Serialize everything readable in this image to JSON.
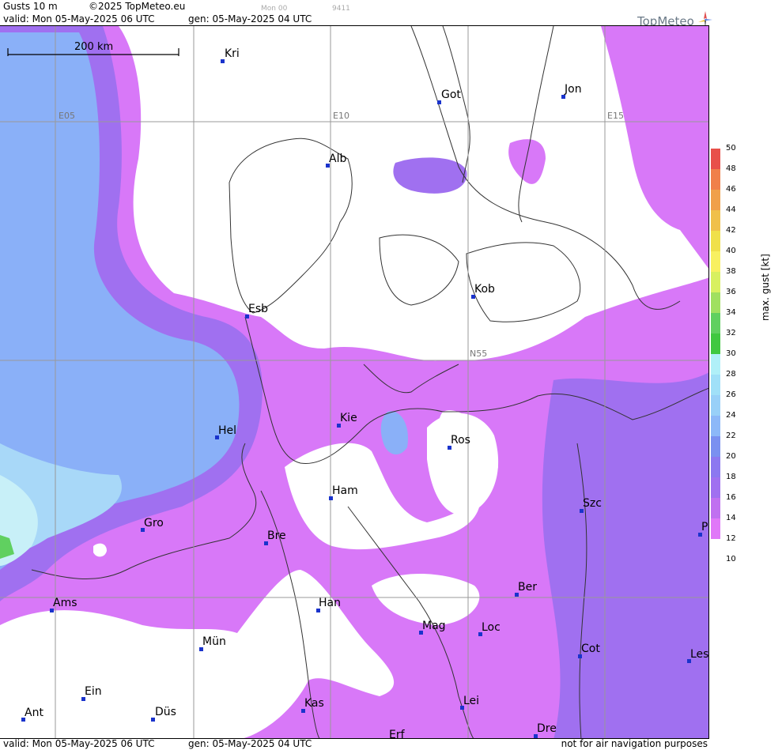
{
  "header": {
    "product": "Gusts 10 m",
    "copyright": "©2025 TopMeteo.eu",
    "run": "Mon 00",
    "code": "9411",
    "valid": "valid:  Mon  05-May-2025  06 UTC",
    "gen": "gen: 05-May-2025 04 UTC",
    "logo": "TopMeteo"
  },
  "footer": {
    "valid": "valid:  Mon  05-May-2025  06 UTC",
    "gen": "gen: 05-May-2025 04 UTC",
    "note": "not for air navigation purposes"
  },
  "scale_bar": "200 km",
  "grid_labels": {
    "lon1": "E05",
    "lon2": "E10",
    "lon3": "E15",
    "lat": "N55"
  },
  "legend": {
    "title": "max. gust [kt]",
    "ticks": [
      "50",
      "48",
      "46",
      "44",
      "42",
      "40",
      "38",
      "36",
      "34",
      "32",
      "30",
      "28",
      "26",
      "24",
      "22",
      "20",
      "18",
      "16",
      "14",
      "12",
      "10"
    ],
    "colors": [
      "#e8504a",
      "#f0804a",
      "#f0a04a",
      "#f0c04a",
      "#f0e04a",
      "#f8f060",
      "#d8f060",
      "#a0e060",
      "#60d060",
      "#40c840",
      "#b0f0f8",
      "#a0e0f8",
      "#98d0f8",
      "#8cb8f8",
      "#7a90f0",
      "#8c78f0",
      "#a070f0",
      "#c070f0",
      "#e078f8"
    ]
  },
  "cities": [
    {
      "name": "Kri"
    },
    {
      "name": "Got"
    },
    {
      "name": "Jon"
    },
    {
      "name": "Alb"
    },
    {
      "name": "Kob"
    },
    {
      "name": "Esb"
    },
    {
      "name": "Kie"
    },
    {
      "name": "Hel"
    },
    {
      "name": "Ros"
    },
    {
      "name": "Ham"
    },
    {
      "name": "Szc"
    },
    {
      "name": "Gro"
    },
    {
      "name": "Bre"
    },
    {
      "name": "P"
    },
    {
      "name": "Ber"
    },
    {
      "name": "Ams"
    },
    {
      "name": "Han"
    },
    {
      "name": "Mag"
    },
    {
      "name": "Loc"
    },
    {
      "name": "Mün"
    },
    {
      "name": "Cot"
    },
    {
      "name": "Les"
    },
    {
      "name": "Ein"
    },
    {
      "name": "Kas"
    },
    {
      "name": "Lei"
    },
    {
      "name": "Ant"
    },
    {
      "name": "Düs"
    },
    {
      "name": "Dre"
    },
    {
      "name": "Erf"
    }
  ]
}
